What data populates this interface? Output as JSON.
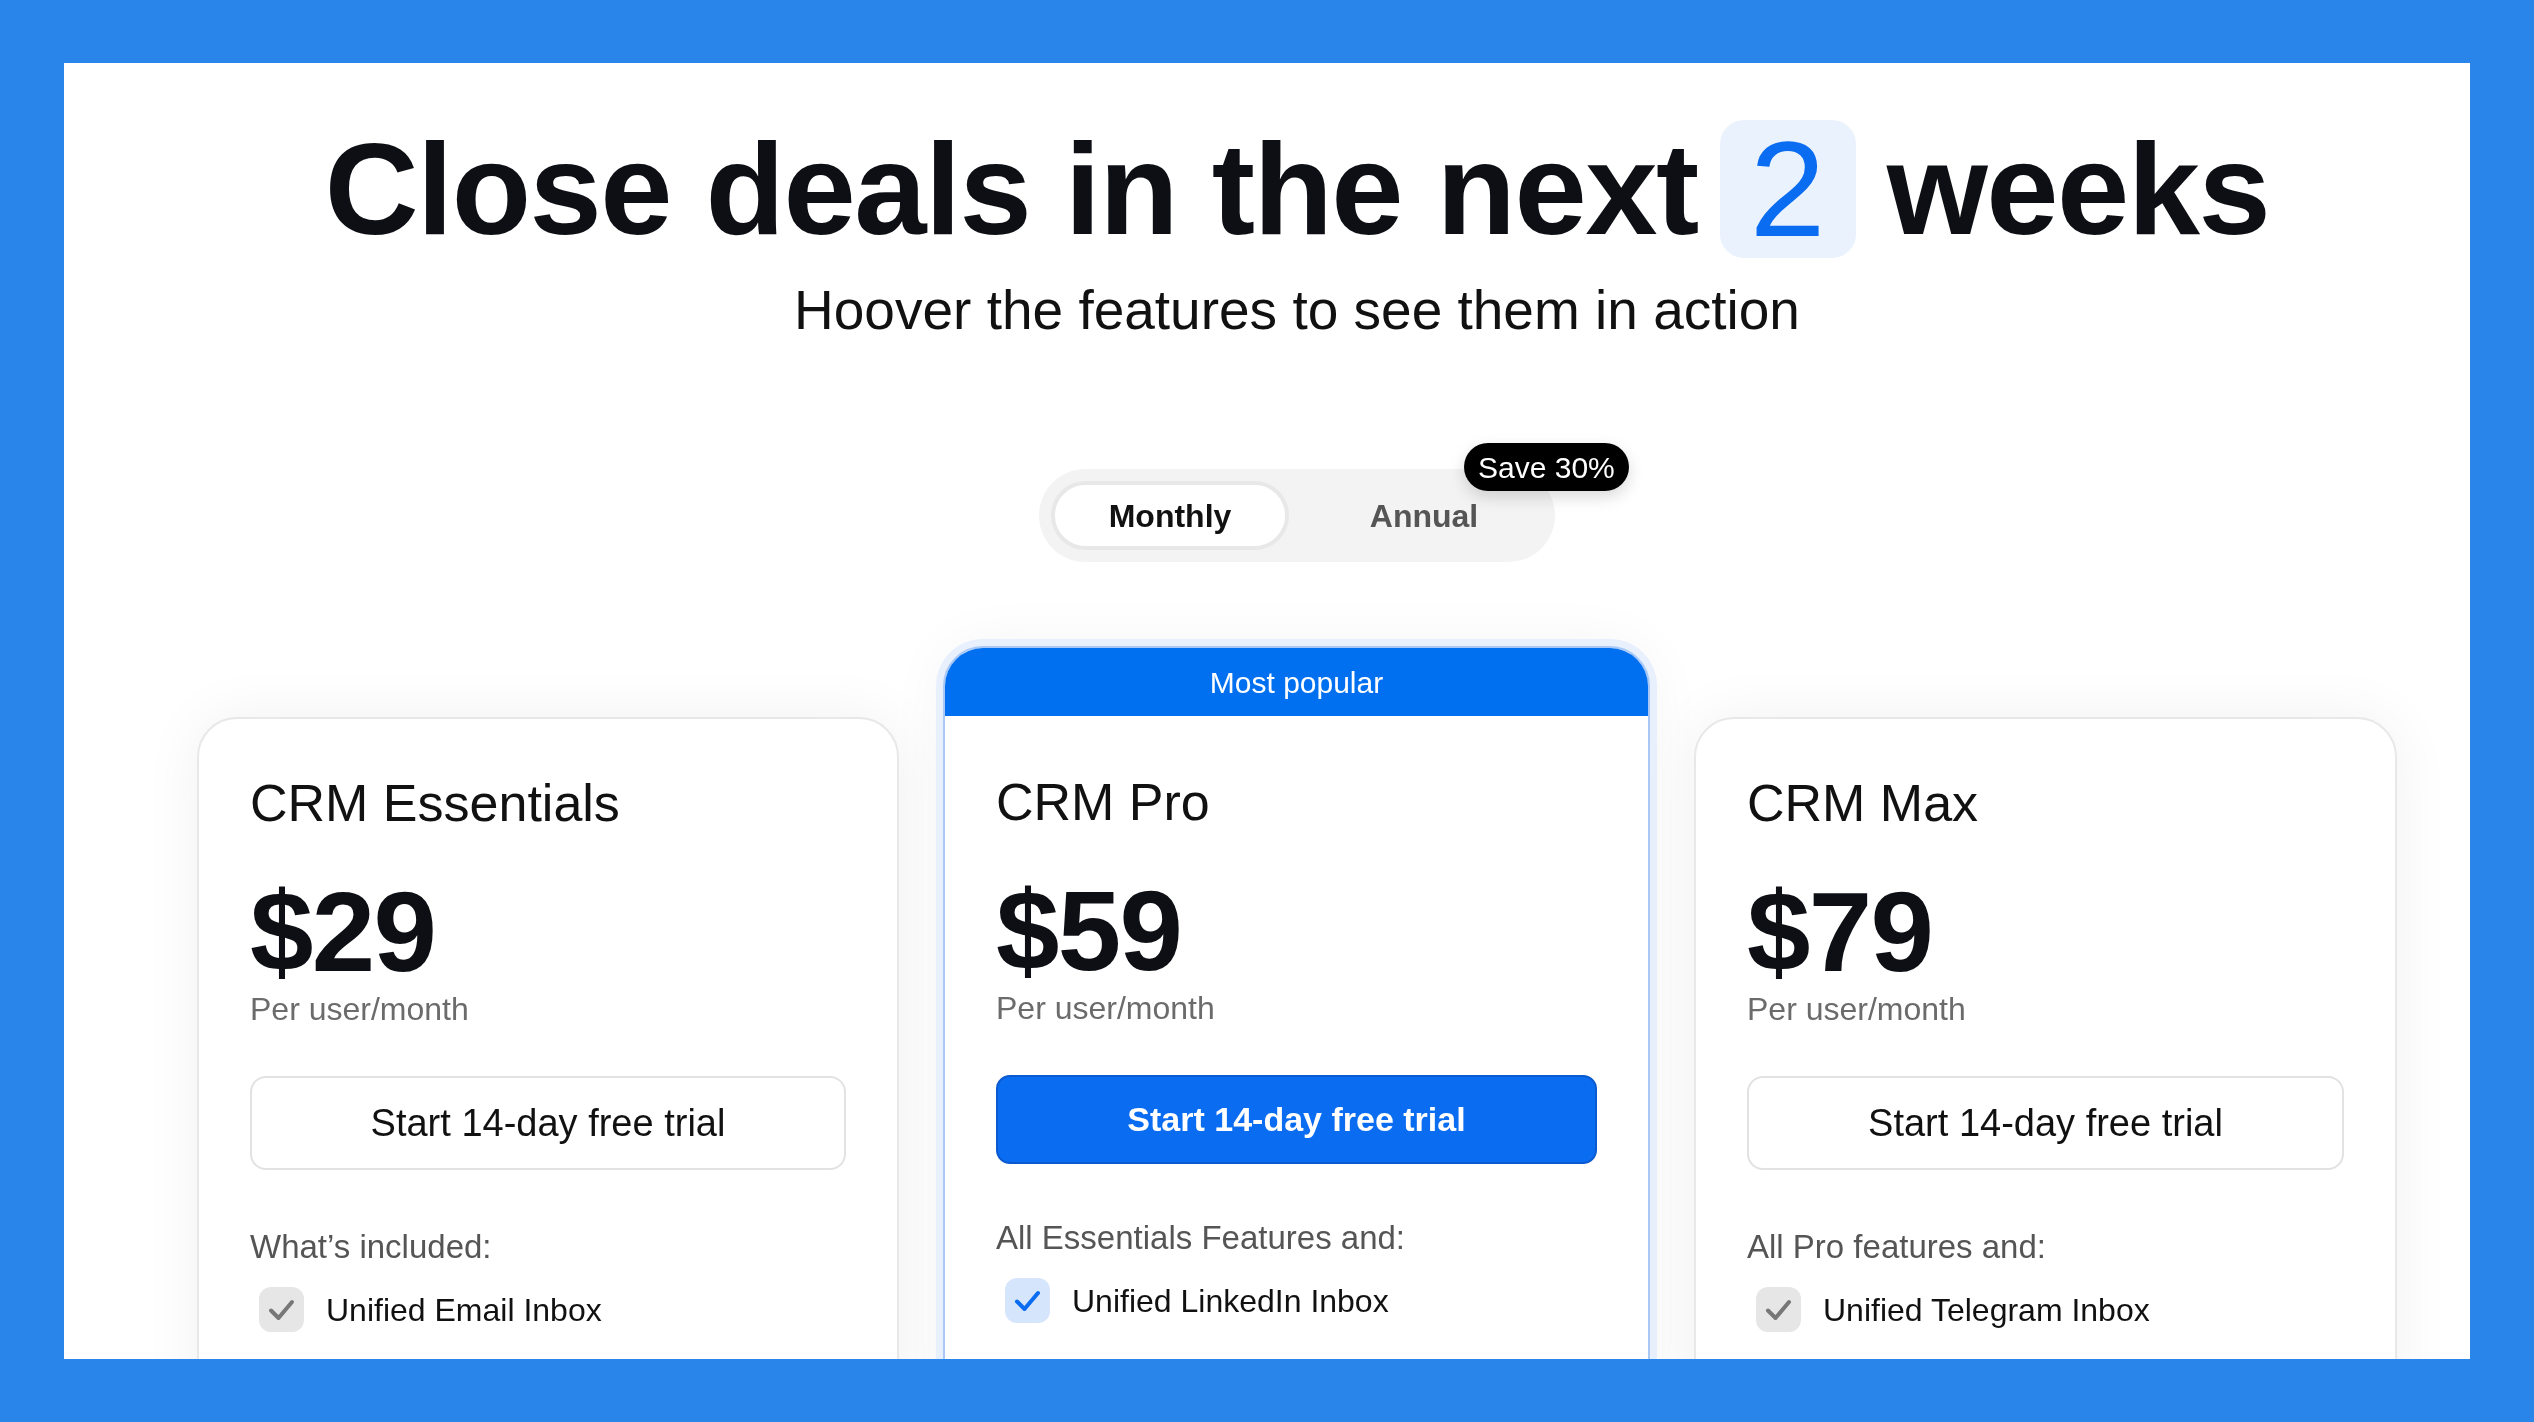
{
  "headline": {
    "before": "Close deals in the next",
    "highlight": "2",
    "after": "weeks"
  },
  "subtitle": "Hoover the features to see them in action",
  "billing_toggle": {
    "options": [
      {
        "label": "Monthly",
        "selected": true
      },
      {
        "label": "Annual",
        "selected": false
      }
    ],
    "badge": "Save 30%"
  },
  "plans": [
    {
      "name": "CRM Essentials",
      "price": "$29",
      "period": "Per user/month",
      "cta": "Start 14-day free trial",
      "featured": false,
      "features_heading": "What’s included:",
      "features": [
        "Unified Email Inbox"
      ]
    },
    {
      "ribbon": "Most popular",
      "name": "CRM Pro",
      "price": "$59",
      "period": "Per user/month",
      "cta": "Start 14-day free trial",
      "featured": true,
      "features_heading": "All Essentials Features and:",
      "features": [
        "Unified LinkedIn Inbox"
      ]
    },
    {
      "name": "CRM Max",
      "price": "$79",
      "period": "Per user/month",
      "cta": "Start 14-day free trial",
      "featured": false,
      "features_heading": "All Pro features and:",
      "features": [
        "Unified Telegram Inbox"
      ]
    }
  ]
}
